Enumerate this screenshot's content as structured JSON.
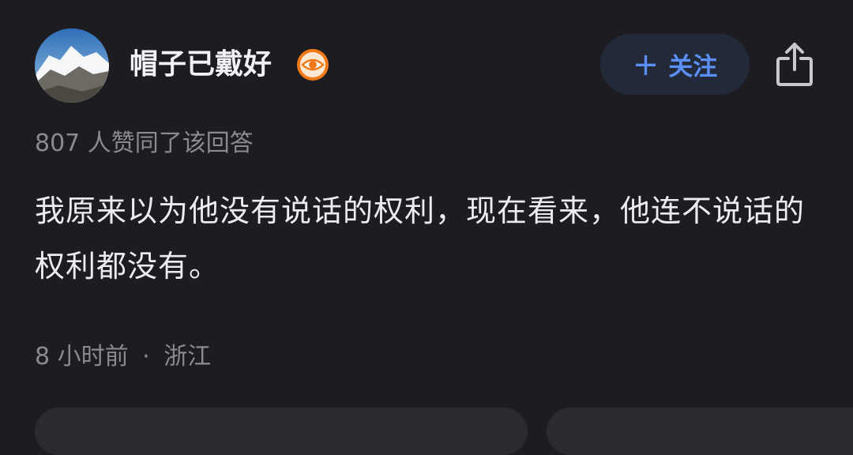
{
  "author": {
    "name": "帽子已戴好"
  },
  "follow_button": {
    "plus": "+",
    "label": "关注"
  },
  "vote_info": "807 人赞同了该回答",
  "answer": {
    "content": "我原来以为他没有说话的权利，现在看来，他连不说话的权利都没有。"
  },
  "meta": {
    "time": "8 小时前",
    "separator": "·",
    "location": "浙江"
  },
  "colors": {
    "background": "#1c1c21",
    "accent": "#5b8ff5",
    "badge": "#f07a1a"
  },
  "icons": {
    "badge": "eye-badge-icon",
    "share": "share-icon"
  }
}
